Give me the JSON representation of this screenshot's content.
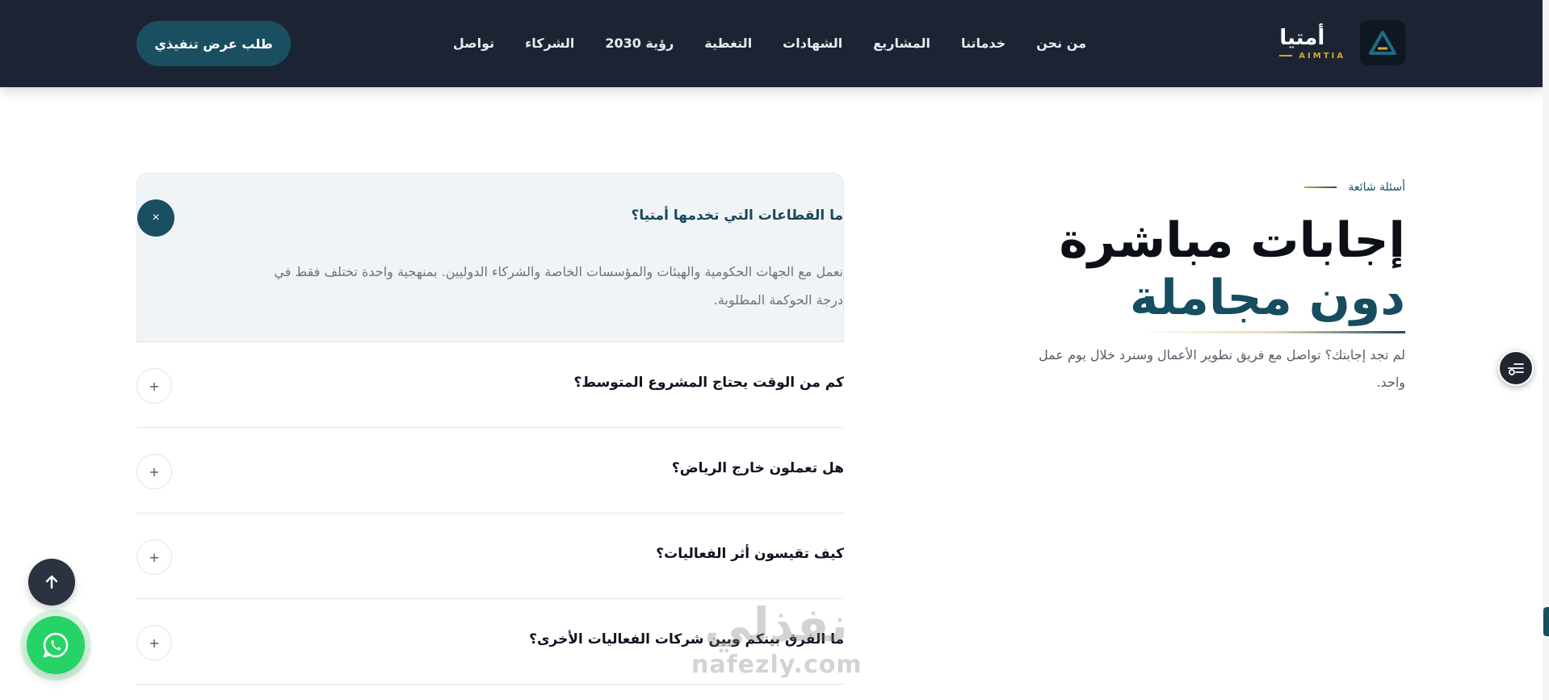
{
  "header": {
    "brand_name": "أمتيا",
    "brand_latin": "AIMTIA",
    "nav": [
      {
        "label": "من نحن"
      },
      {
        "label": "خدماتنا"
      },
      {
        "label": "المشاريع"
      },
      {
        "label": "الشهادات"
      },
      {
        "label": "التغطية"
      },
      {
        "label": "رؤية 2030"
      },
      {
        "label": "الشركاء"
      },
      {
        "label": "تواصل"
      }
    ],
    "cta_label": "طلب عرض تنفيذي"
  },
  "intro": {
    "eyebrow": "أسئلة شائعة",
    "headline_line1": "إجابات مباشرة",
    "headline_line2": "دون مجاملة",
    "description": "لم تجد إجابتك؟ تواصل مع فريق تطوير الأعمال وسنرد خلال يوم عمل واحد."
  },
  "faq": {
    "open": {
      "question": "ما القطاعات التي تخدمها أمتيا؟",
      "answer": "نعمل مع الجهات الحكومية والهيئات والمؤسسات الخاصة والشركاء الدوليين. بمنهجية واحدة تختلف فقط في درجة الحوكمة المطلوبة.",
      "toggle": "×"
    },
    "items": [
      {
        "question": "كم من الوقت يحتاج المشروع المتوسط؟",
        "toggle": "+"
      },
      {
        "question": "هل تعملون خارج الرياض؟",
        "toggle": "+"
      },
      {
        "question": "كيف تقيسون أثر الفعاليات؟",
        "toggle": "+"
      },
      {
        "question": "ما الفرق بينكم وبين شركات الفعاليات الأخرى؟",
        "toggle": "+"
      }
    ]
  },
  "watermark": {
    "arabic": "نفذلي",
    "latin": "nafezly.com"
  },
  "colors": {
    "header_bg": "#1c2433",
    "accent": "#1a4f62",
    "gold": "#d4a634",
    "whatsapp": "#25d366"
  },
  "icons": {
    "logo": "triangle-a-logo-icon",
    "scroll_top": "arrow-up-icon",
    "whatsapp": "whatsapp-icon",
    "side_widget": "sliders-icon"
  }
}
